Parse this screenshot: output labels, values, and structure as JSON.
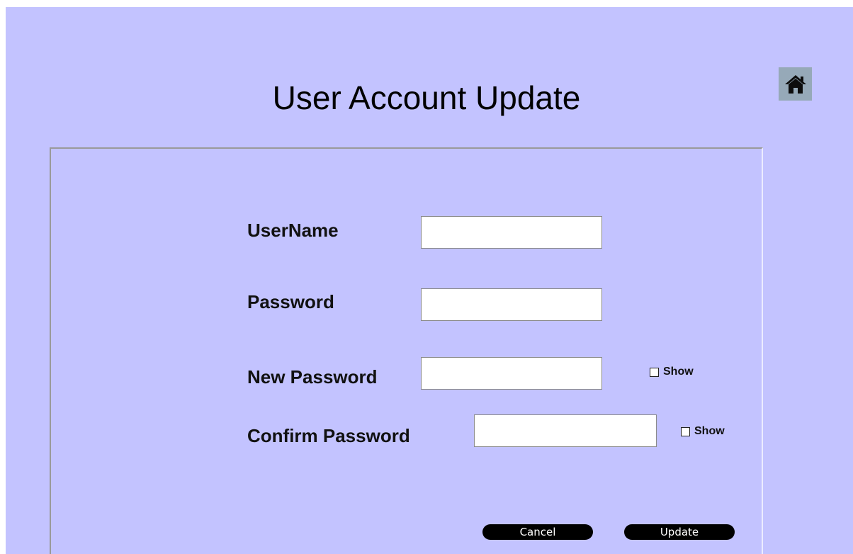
{
  "header": {
    "title": "User Account Update",
    "home_icon": "home-icon"
  },
  "form": {
    "username_label": "UserName",
    "username_value": "",
    "password_label": "Password",
    "password_value": "",
    "new_password_label": "New Password",
    "new_password_value": "",
    "new_password_show": "Show",
    "confirm_password_label": "Confirm Password",
    "confirm_password_value": "",
    "confirm_password_show": "Show"
  },
  "actions": {
    "cancel_label": "Cancel",
    "update_label": "Update"
  },
  "colors": {
    "background": "#c3c3ff",
    "home_button_bg": "#96a9b8",
    "button_bg": "#000000"
  }
}
